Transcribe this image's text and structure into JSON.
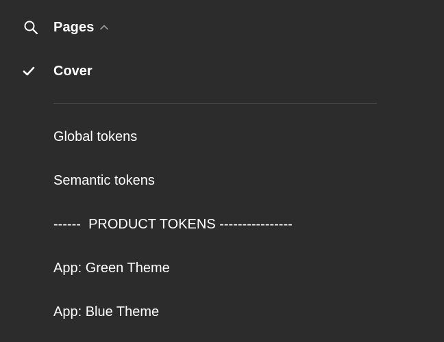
{
  "header": {
    "search_icon": "search-icon",
    "title": "Pages",
    "toggle_icon": "chevron-up-icon"
  },
  "pages": [
    {
      "label": "Cover",
      "selected": true,
      "icon": "check-icon"
    },
    {
      "label": "Global tokens",
      "selected": false
    },
    {
      "label": "Semantic tokens",
      "selected": false
    },
    {
      "label": "------  PRODUCT TOKENS ----------------",
      "selected": false
    },
    {
      "label": "App: Green Theme",
      "selected": false
    },
    {
      "label": "App: Blue Theme",
      "selected": false
    }
  ],
  "colors": {
    "background": "#2c2c2c",
    "text": "#ffffff",
    "divider": "#474747",
    "chevron": "#9a9a9a"
  }
}
